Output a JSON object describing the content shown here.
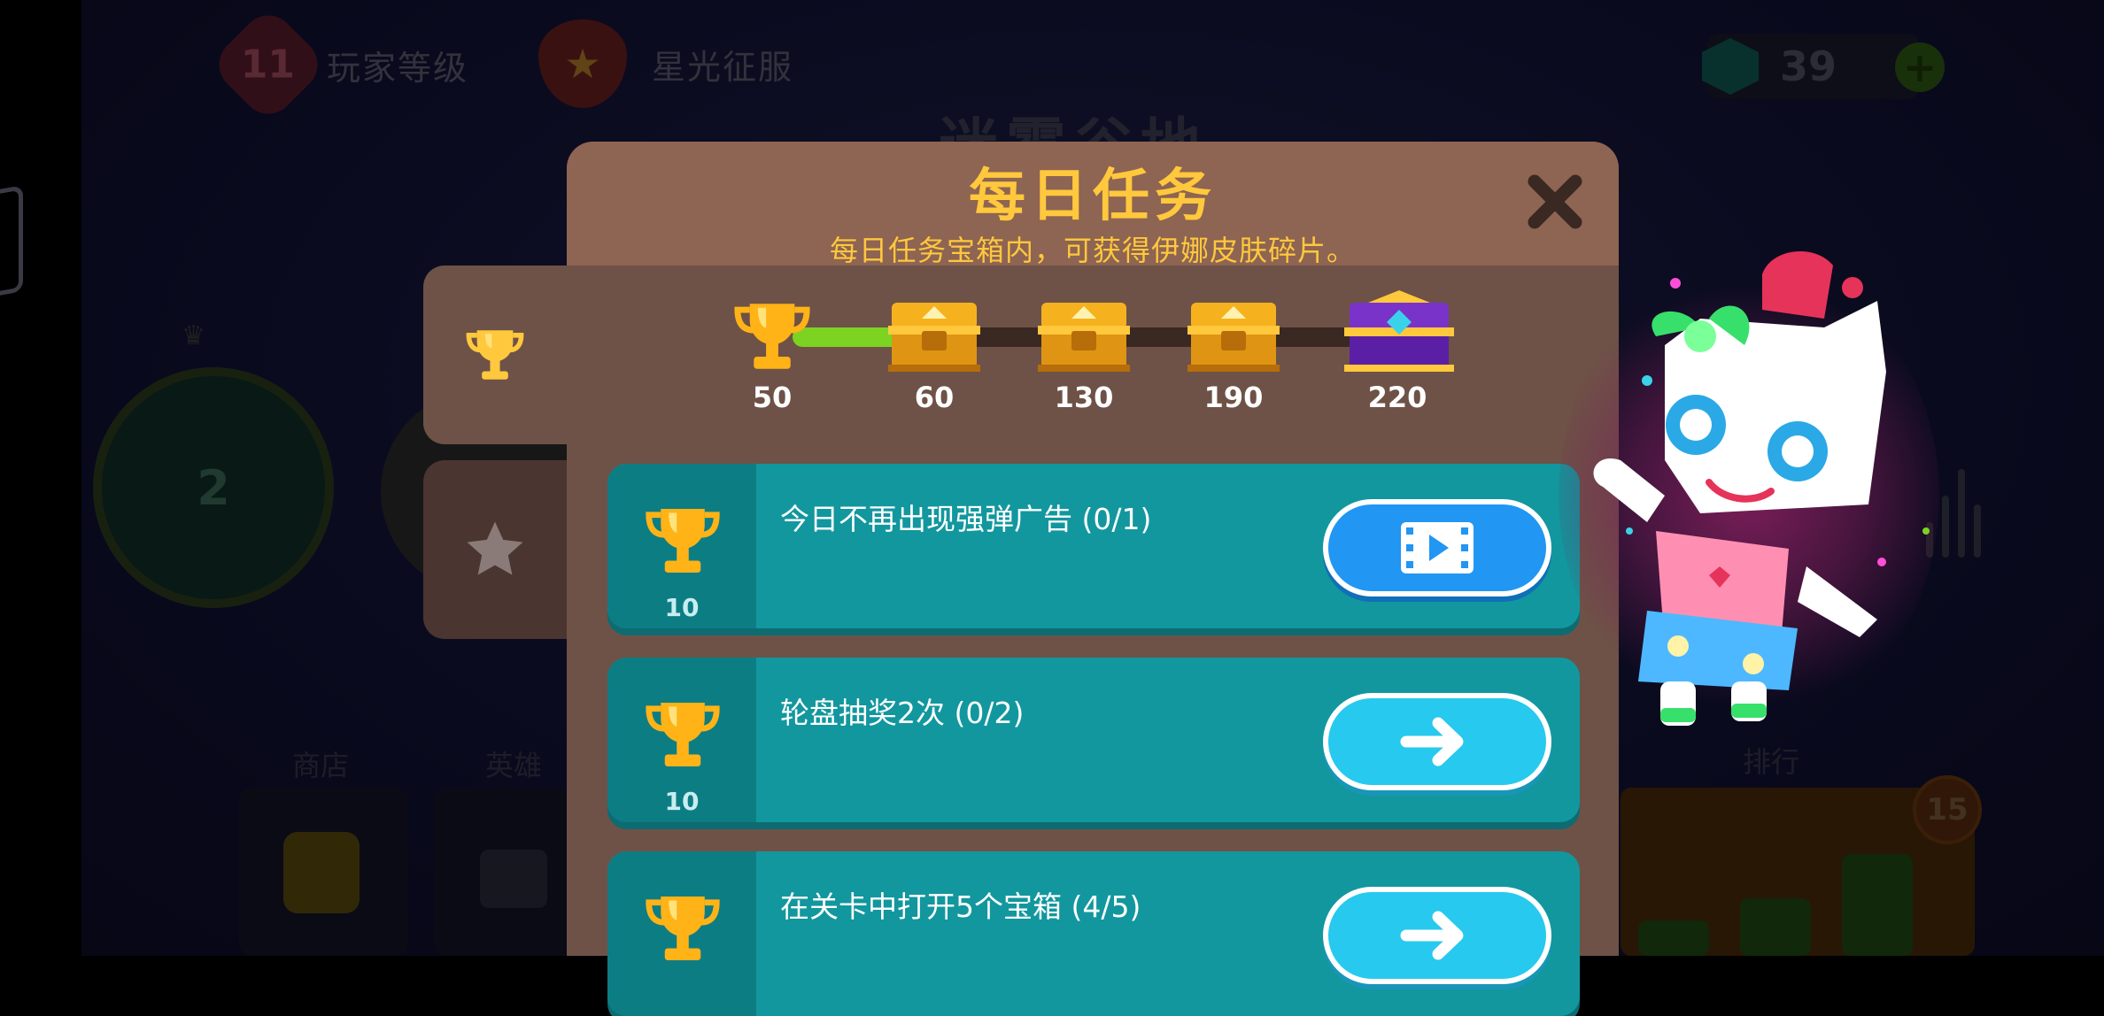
{
  "topbar": {
    "player_level": "11",
    "player_level_label": "玩家等级",
    "star_conquest_label": "星光征服",
    "gems": "39"
  },
  "background": {
    "faded_title": "迷雾谷地",
    "level_circle_number": "2",
    "shop_label": "商店",
    "heroes_label": "英雄",
    "ranking_label": "排行",
    "badge_number": "15"
  },
  "dialog": {
    "title": "每日任务",
    "subtitle": "每日任务宝箱内，可获得伊娜皮肤碎片。",
    "progress": {
      "current": 50,
      "current_label": "50",
      "milestones": [
        {
          "label": "60",
          "type": "gold-chest"
        },
        {
          "label": "130",
          "type": "gold-chest"
        },
        {
          "label": "190",
          "type": "gold-chest"
        },
        {
          "label": "220",
          "type": "purple-chest"
        }
      ]
    },
    "tasks": [
      {
        "description": "今日不再出现强弹广告 (0/1)",
        "reward": "10",
        "button": "video"
      },
      {
        "description": "轮盘抽奖2次 (0/2)",
        "reward": "10",
        "button": "go"
      },
      {
        "description": "在关卡中打开5个宝箱 (4/5)",
        "reward": "",
        "button": "go"
      }
    ]
  },
  "colors": {
    "accent_gold": "#ffc83d",
    "task_bg": "#12979e",
    "progress_fill": "#7cd322",
    "dialog_bg": "#6e5247"
  }
}
